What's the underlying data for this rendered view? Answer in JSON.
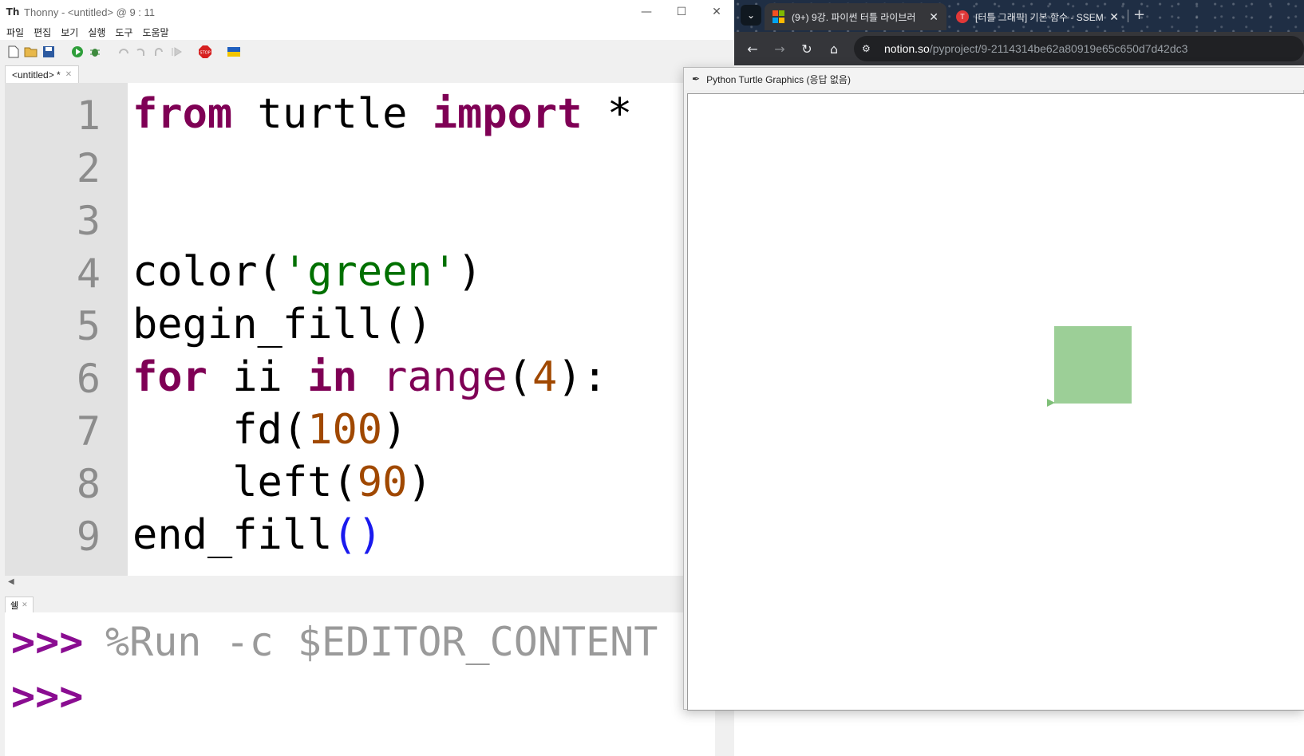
{
  "thonny": {
    "title": "Thonny  -  <untitled>  @  9 : 11",
    "menu": [
      "파일",
      "편집",
      "보기",
      "실행",
      "도구",
      "도움말"
    ],
    "editor_tab": "<untitled>  *",
    "shell_tab": "쉘",
    "line_numbers": [
      "1",
      "2",
      "3",
      "4",
      "5",
      "6",
      "7",
      "8",
      "9"
    ],
    "code": {
      "l1_kw1": "from",
      "l1_mod": " turtle ",
      "l1_kw2": "import",
      "l1_star": " *",
      "l4_fn": "color(",
      "l4_str": "'green'",
      "l4_end": ")",
      "l5": "begin_fill()",
      "l6_kw1": "for",
      "l6_var": " ii ",
      "l6_kw2": "in",
      "l6_sp": " ",
      "l6_bi": "range",
      "l6_open": "(",
      "l6_num": "4",
      "l6_end": "):",
      "l7_fn": "    fd(",
      "l7_num": "100",
      "l7_end": ")",
      "l8_fn": "    left(",
      "l8_num": "90",
      "l8_end": ")",
      "l9_fn": "end_fill",
      "l9_par": "()"
    },
    "shell": {
      "prompt": ">>>",
      "command": "%Run -c $EDITOR_CONTENT"
    }
  },
  "chrome": {
    "tabs": [
      {
        "label": "(9+) 9강. 파이썬 터틀 라이브러",
        "active": true
      },
      {
        "label": "[터틀 그래픽] 기본 함수 - SSEM",
        "active": false
      }
    ],
    "url_host": "notion.so",
    "url_path": "/pyproject/9-2114314be62a80919e65c650d7d42dc3"
  },
  "turtle_window": {
    "title": "Python Turtle Graphics (응답 없음)",
    "fill_color": "#9ccf97"
  }
}
